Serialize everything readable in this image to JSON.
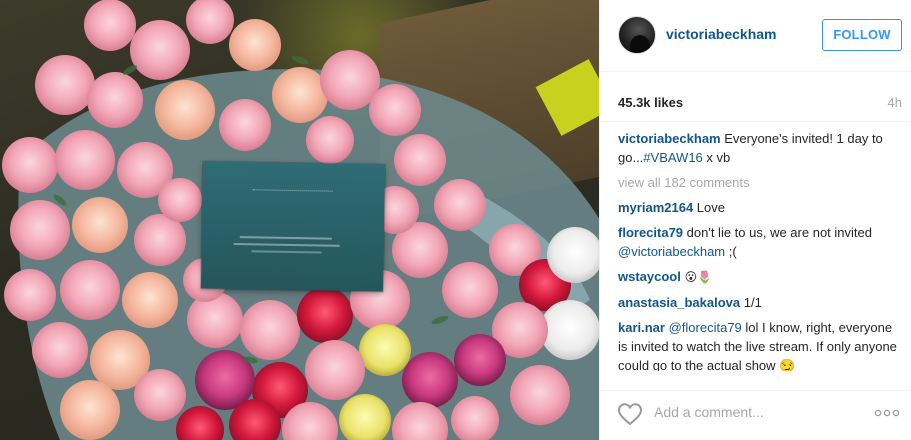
{
  "post": {
    "username": "victoriabeckham",
    "follow_label": "FOLLOW",
    "likes": "45.3k likes",
    "time_ago": "4h",
    "caption": {
      "user": "victoriabeckham",
      "text": " Everyone's invited! 1 day to go...",
      "hashtag": "#VBAW16",
      "suffix": " x vb"
    },
    "view_all": "view all 182 comments",
    "comments": [
      {
        "user": "myriam2164",
        "text": " Love"
      },
      {
        "user": "florecita79",
        "text": " don't lie to us, we are not invited ",
        "mention": "@victoriabeckham",
        "suffix": " ;("
      },
      {
        "user": "wstaycool",
        "text": " 😮🌷"
      },
      {
        "user": "anastasia_bakalova",
        "text": " 1/1"
      },
      {
        "user": "kari.nar",
        "mention": "@florecita79",
        "text": " lol I know, right, everyone is invited to watch the live stream. If only anyone could go to the actual show 😏"
      }
    ],
    "add_comment_placeholder": "Add a comment...",
    "icons": {
      "like": "heart-icon",
      "more": "more-options-icon"
    },
    "colors": {
      "link": "#125688",
      "follow": "#3897f0",
      "muted": "#a5a7aa"
    }
  }
}
